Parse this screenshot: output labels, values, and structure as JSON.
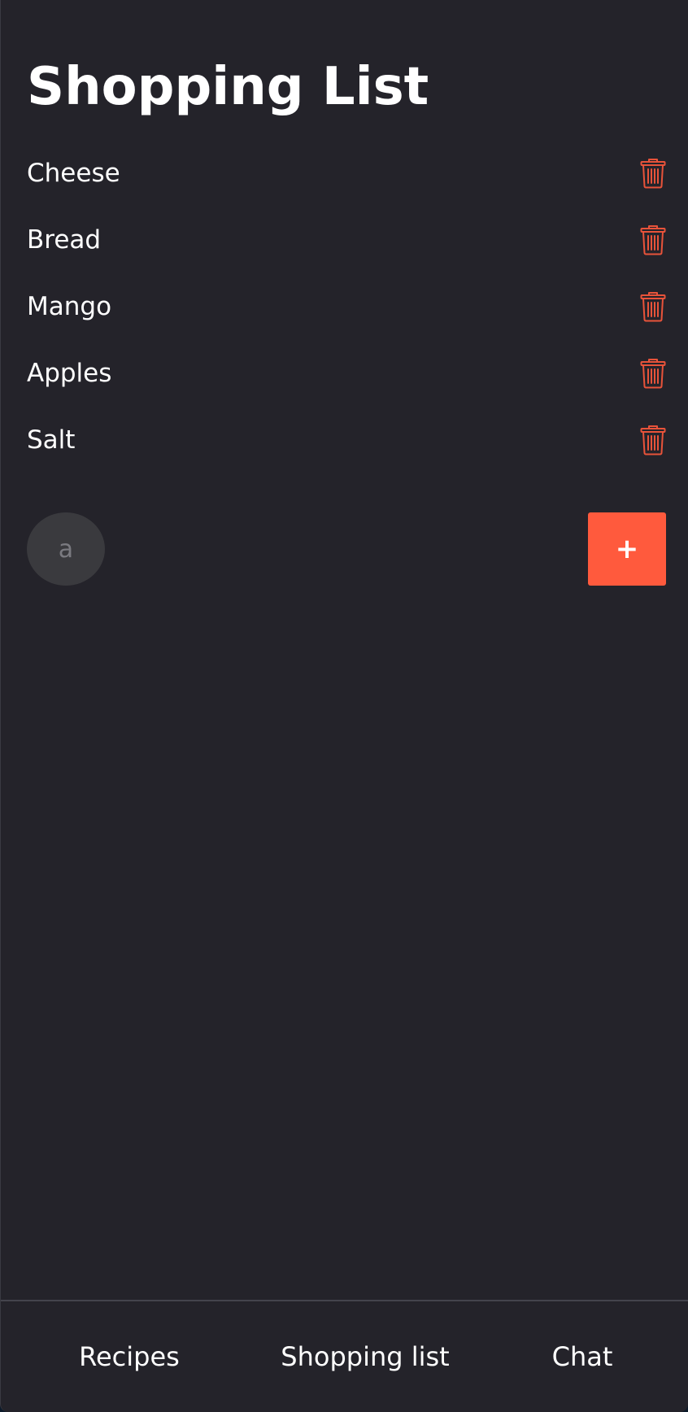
{
  "page": {
    "title": "Shopping List"
  },
  "items": [
    {
      "label": "Cheese"
    },
    {
      "label": "Bread"
    },
    {
      "label": "Mango"
    },
    {
      "label": "Apples"
    },
    {
      "label": "Salt"
    }
  ],
  "add_row": {
    "avatar_letter": "a",
    "add_label": "+"
  },
  "nav": {
    "recipes": "Recipes",
    "shopping_list": "Shopping list",
    "chat": "Chat"
  },
  "colors": {
    "background": "#24232a",
    "accent": "#ff5a3d",
    "text": "#ffffff"
  },
  "icons": {
    "delete": "trash-icon"
  }
}
